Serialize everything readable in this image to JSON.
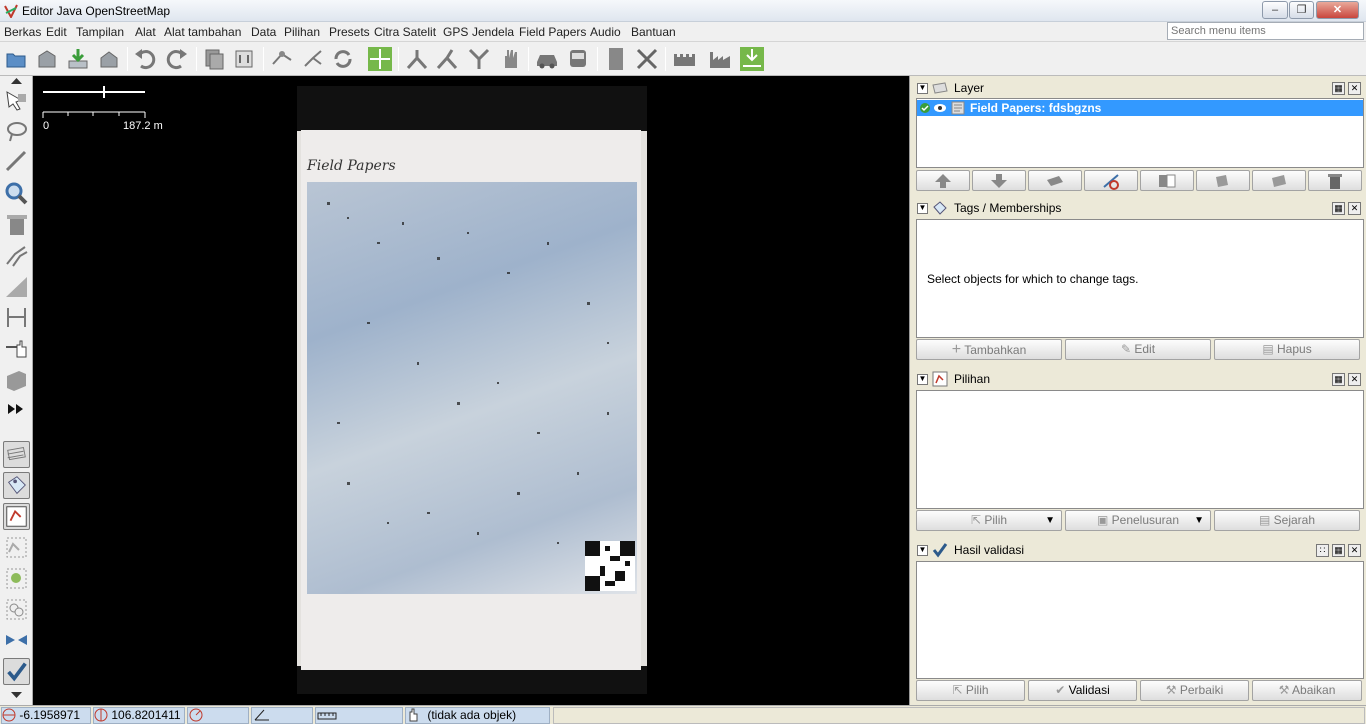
{
  "window": {
    "title": "Editor Java OpenStreetMap"
  },
  "menubar": {
    "items": [
      "Berkas",
      "Edit",
      "Tampilan",
      "Alat",
      "Alat tambahan",
      "Data",
      "Pilihan",
      "Presets",
      "Citra Satelit",
      "GPS",
      "Jendela",
      "Field Papers",
      "Audio",
      "Bantuan"
    ],
    "search_placeholder": "Search menu items"
  },
  "toolbar": {
    "icons": [
      "open-file-icon",
      "save-icon",
      "download-icon",
      "upload-icon",
      "undo-icon",
      "redo-icon",
      "copy-icon",
      "paste-tags-icon",
      "wireframe-icon",
      "split-way-icon",
      "refresh-icon",
      "zoom-to-selection-icon",
      "combine-way-icon",
      "split-icon",
      "join-icon",
      "hand-icon",
      "car-icon",
      "bus-icon",
      "barrier-icon",
      "tools-icon",
      "castle-icon",
      "factory-icon",
      "download-imagery-icon"
    ]
  },
  "lefttools": {
    "icons": [
      "select-icon",
      "lasso-icon",
      "draw-icon",
      "zoom-icon",
      "delete-icon",
      "parallel-icon",
      "improve-way-icon",
      "extrude-icon",
      "drag-icon",
      "building-icon",
      "more-tools-icon",
      "layer-list-toggle-icon",
      "tags-toggle-icon",
      "selection-list-toggle-icon",
      "relation-list-toggle-icon",
      "author-list-toggle-icon",
      "history-toggle-icon",
      "conflict-toggle-icon",
      "validation-toggle-icon"
    ]
  },
  "map": {
    "scale_start": "0",
    "scale_end": "187.2 m",
    "paper_title": "Field Papers"
  },
  "layers_panel": {
    "title": "Layer",
    "layer_name": "Field Papers: fdsbgzns",
    "button_icons": [
      "move-up-icon",
      "move-down-icon",
      "merge-icon",
      "toggle-visible-icon",
      "opacity-icon",
      "duplicate-icon",
      "merge-layer-icon",
      "delete-layer-icon"
    ]
  },
  "tags_panel": {
    "title": "Tags / Memberships",
    "empty_message": "Select objects for which to change tags.",
    "add_label": "Tambahkan",
    "edit_label": "Edit",
    "delete_label": "Hapus"
  },
  "selection_panel": {
    "title": "Pilihan",
    "select_label": "Pilih",
    "search_label": "Penelusuran",
    "history_label": "Sejarah"
  },
  "validation_panel": {
    "title": "Hasil validasi",
    "select_label": "Pilih",
    "validate_label": "Validasi",
    "fix_label": "Perbaiki",
    "ignore_label": "Abaikan"
  },
  "statusbar": {
    "lat": "-6.1958971",
    "lon": "106.8201411",
    "heading": "",
    "angle": "",
    "distance": "",
    "object": "(tidak ada objek)"
  },
  "colors": {
    "selection": "#3399ff",
    "map_background": "#000000"
  }
}
